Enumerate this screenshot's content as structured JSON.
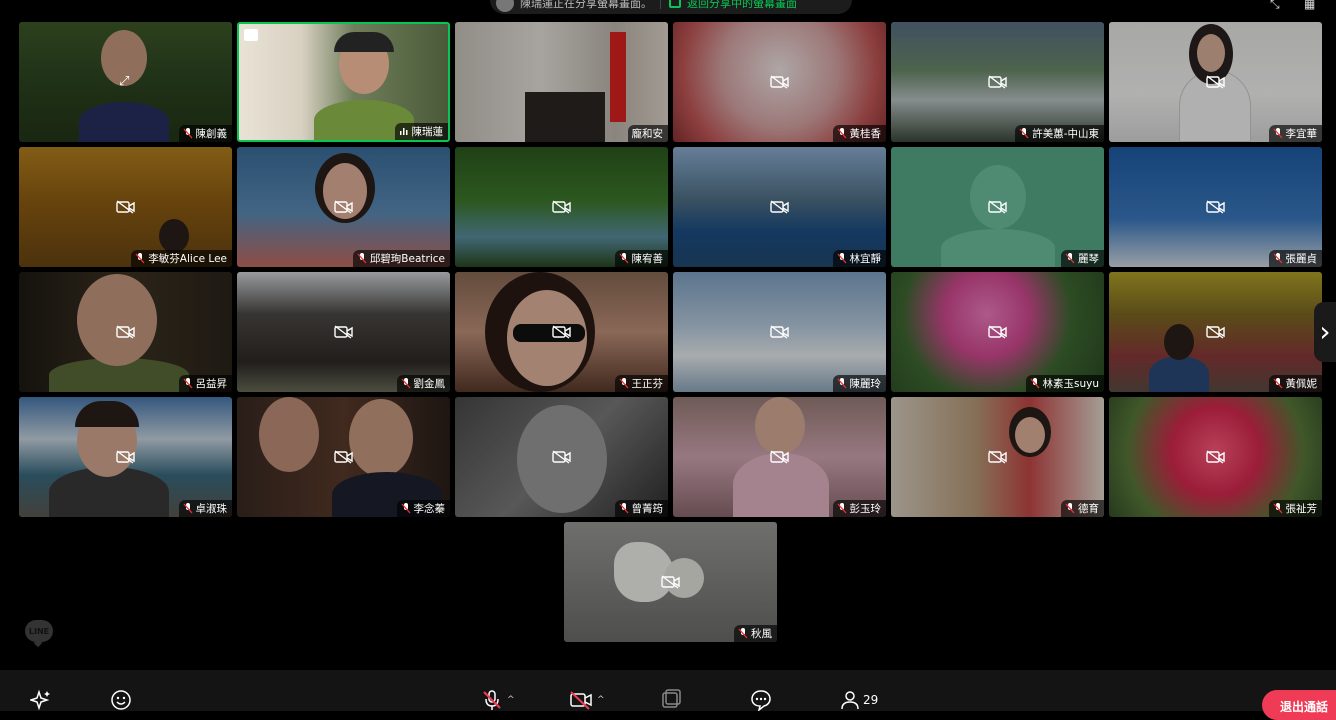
{
  "banner": {
    "share_text": "陳瑞蓮正在分享螢幕畫面。",
    "return_text": "返回分享中的螢幕畫面"
  },
  "participants": [
    {
      "name": "陳創義"
    },
    {
      "name": "陳瑞蓮"
    },
    {
      "name": "龐和安"
    },
    {
      "name": "黃桂香"
    },
    {
      "name": "許美蕙-中山東"
    },
    {
      "name": "李宜華"
    },
    {
      "name": "李敏芬Alice Lee"
    },
    {
      "name": "邱碧珣Beatrice"
    },
    {
      "name": "陳宥善"
    },
    {
      "name": "林宜靜"
    },
    {
      "name": "麗琴"
    },
    {
      "name": "張麗貞"
    },
    {
      "name": "呂益昇"
    },
    {
      "name": "劉金鳳"
    },
    {
      "name": "王正芬"
    },
    {
      "name": "陳麗玲"
    },
    {
      "name": "林素玉suyu"
    },
    {
      "name": "黃佩妮"
    },
    {
      "name": "卓淑珠"
    },
    {
      "name": "李念蓁"
    },
    {
      "name": "曾菁筠"
    },
    {
      "name": "彭玉玲"
    },
    {
      "name": "德育"
    },
    {
      "name": "張祉芳"
    },
    {
      "name": "秋風"
    }
  ],
  "logo": {
    "text": "LINE"
  },
  "toolbar": {
    "participant_count": "29",
    "leave_label": "退出通話"
  },
  "icons": {
    "effects": "sparkle-icon",
    "emoji": "smiley-icon",
    "mic": "mic-off-icon",
    "camera": "camera-off-icon",
    "share": "screen-share-icon",
    "chat": "chat-icon",
    "participants": "person-icon"
  },
  "colors": {
    "speaking_border": "#06c755",
    "leave_button": "#f03b56",
    "background": "#000000"
  }
}
